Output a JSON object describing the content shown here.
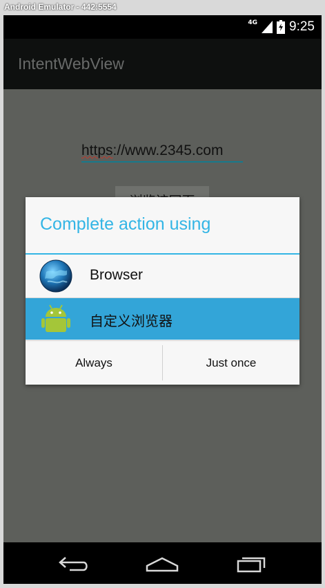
{
  "window": {
    "title": "Android Emulator - 442:5554"
  },
  "status_bar": {
    "network": "4G",
    "time": "9:25",
    "icons": [
      "signal-icon",
      "battery-icon"
    ]
  },
  "app": {
    "title": "IntentWebView"
  },
  "main": {
    "url_value": "https://www.2345.com",
    "url_squiggle": "https",
    "url_rest": "://www.2345.com",
    "browse_button": "浏览该网页"
  },
  "dialog": {
    "title": "Complete action using",
    "apps": [
      {
        "label": "Browser",
        "icon": "globe-icon"
      },
      {
        "label": "自定义浏览器",
        "icon": "android-icon",
        "selected": true
      }
    ],
    "buttons": {
      "always": "Always",
      "just_once": "Just once"
    }
  },
  "nav": {
    "icons": [
      "back-icon",
      "home-icon",
      "recents-icon"
    ]
  },
  "colors": {
    "accent": "#33b5e5",
    "selected_row": "#33a5d8",
    "actionbar": "#0e100f",
    "scrim": "#5d5f5b"
  }
}
